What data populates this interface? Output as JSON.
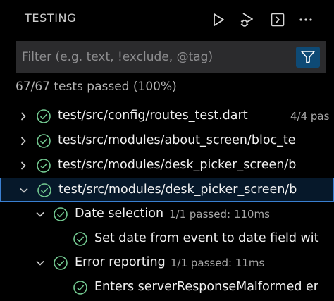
{
  "header": {
    "title": "TESTING",
    "actions": [
      {
        "name": "run-tests-icon"
      },
      {
        "name": "debug-tests-icon"
      },
      {
        "name": "show-output-icon"
      },
      {
        "name": "more-actions-icon"
      }
    ]
  },
  "filter": {
    "placeholder": "Filter (e.g. text, !exclude, @tag)",
    "value": "",
    "filter_icon": "funnel-icon"
  },
  "summary": "67/67 tests passed (100%)",
  "colors": {
    "pass": "#73c991",
    "accent": "#0e4a75",
    "selection_border": "#3a7fd1"
  },
  "tree": {
    "rows": [
      {
        "label": "test/src/config/routes_test.dart",
        "meta": "4/4 pas",
        "expanded": false,
        "selected": false
      },
      {
        "label": "test/src/modules/about_screen/bloc_te",
        "meta": "",
        "expanded": false,
        "selected": false
      },
      {
        "label": "test/src/modules/desk_picker_screen/b",
        "meta": "",
        "expanded": false,
        "selected": false
      },
      {
        "label": "test/src/modules/desk_picker_screen/b",
        "meta": "",
        "expanded": true,
        "selected": true
      },
      {
        "label": "Date selection",
        "meta": "1/1 passed: 110ms",
        "expanded": true,
        "selected": false
      },
      {
        "label": "Set date from event to date field wit",
        "meta": "",
        "expanded": null,
        "selected": false
      },
      {
        "label": "Error reporting",
        "meta": "1/1 passed: 11ms",
        "expanded": true,
        "selected": false
      },
      {
        "label": "Enters serverResponseMalformed er",
        "meta": "",
        "expanded": null,
        "selected": false
      }
    ]
  }
}
